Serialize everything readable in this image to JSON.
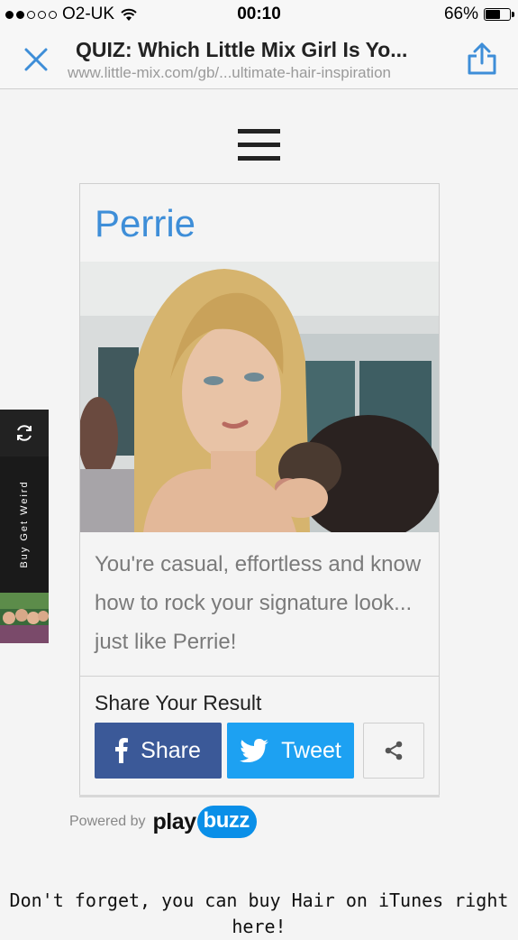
{
  "status_bar": {
    "carrier": "O2-UK",
    "time": "00:10",
    "battery": "66%",
    "battery_level": 0.66,
    "signal_bars": 2,
    "wifi_icon": "wifi-icon"
  },
  "browser": {
    "title": "QUIZ: Which Little Mix Girl Is Yo...",
    "url": "www.little-mix.com/gb/...ultimate-hair-inspiration",
    "close_icon": "close-icon",
    "share_icon": "share-icon"
  },
  "menu": {
    "icon": "hamburger-menu-icon"
  },
  "result": {
    "name": "Perrie",
    "description": "You're casual, effortless and know how to rock your signature look... just like Perrie!",
    "share_heading": "Share Your Result",
    "facebook_label": "Share",
    "twitter_label": "Tweet",
    "facebook_icon": "facebook-icon",
    "twitter_icon": "twitter-bird-icon",
    "more_icon": "share-nodes-icon"
  },
  "powered_by": {
    "text": "Powered by",
    "brand_play": "play",
    "brand_buzz": "buzz"
  },
  "side_widget": {
    "label": "Buy Get Weird",
    "refresh_icon": "refresh-icon"
  },
  "footer": {
    "text": "Don't forget, you can buy Hair on iTunes right here!"
  },
  "colors": {
    "accent": "#3e8ed8",
    "facebook": "#3b5998",
    "twitter": "#1da1f2",
    "playbuzz": "#0a8fe8"
  }
}
